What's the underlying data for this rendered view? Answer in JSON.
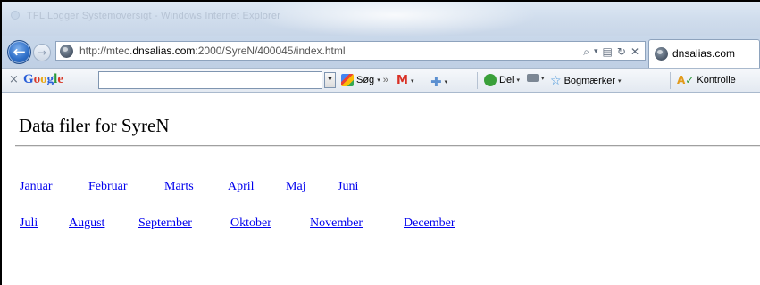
{
  "window": {
    "title": "TFL Logger Systemoversigt - Windows Internet Explorer"
  },
  "nav": {
    "back_glyph": "←",
    "forward_glyph": "→",
    "url_prefix": "http://mtec.",
    "url_host": "dnsalias.com",
    "url_suffix": ":2000/SyreN/400045/index.html",
    "search_glyph": "⌕",
    "dropdown_glyph": "▾",
    "compat_glyph": "▤",
    "refresh_glyph": "↻",
    "stop_glyph": "✕",
    "tab_label": "dnsalias.com"
  },
  "google_toolbar": {
    "close_glyph": "×",
    "logo": [
      "G",
      "o",
      "o",
      "g",
      "l",
      "e"
    ],
    "dropdown_glyph": "▼",
    "search_label": "Søg",
    "share_label": "Del",
    "bookmarks_label": "Bogmærker",
    "spell_label": "Kontrolle",
    "caret": "▾",
    "arrow": "»"
  },
  "page": {
    "title": "Data filer for SyreN",
    "months_row1": [
      "Januar",
      "Februar",
      "Marts",
      "April",
      "Maj",
      "Juni"
    ],
    "months_row2": [
      "Juli",
      "August",
      "September",
      "Oktober",
      "November",
      "December"
    ]
  }
}
